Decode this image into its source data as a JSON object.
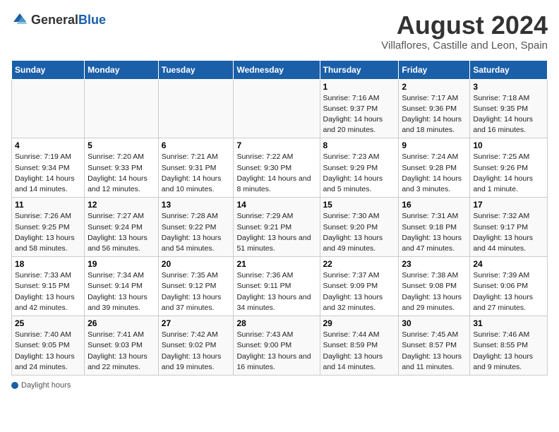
{
  "header": {
    "logo_general": "General",
    "logo_blue": "Blue",
    "title": "August 2024",
    "subtitle": "Villaflores, Castille and Leon, Spain"
  },
  "days_of_week": [
    "Sunday",
    "Monday",
    "Tuesday",
    "Wednesday",
    "Thursday",
    "Friday",
    "Saturday"
  ],
  "weeks": [
    [
      {
        "day": "",
        "content": ""
      },
      {
        "day": "",
        "content": ""
      },
      {
        "day": "",
        "content": ""
      },
      {
        "day": "",
        "content": ""
      },
      {
        "day": "1",
        "content": "Sunrise: 7:16 AM\nSunset: 9:37 PM\nDaylight: 14 hours\nand 20 minutes."
      },
      {
        "day": "2",
        "content": "Sunrise: 7:17 AM\nSunset: 9:36 PM\nDaylight: 14 hours\nand 18 minutes."
      },
      {
        "day": "3",
        "content": "Sunrise: 7:18 AM\nSunset: 9:35 PM\nDaylight: 14 hours\nand 16 minutes."
      }
    ],
    [
      {
        "day": "4",
        "content": "Sunrise: 7:19 AM\nSunset: 9:34 PM\nDaylight: 14 hours\nand 14 minutes."
      },
      {
        "day": "5",
        "content": "Sunrise: 7:20 AM\nSunset: 9:33 PM\nDaylight: 14 hours\nand 12 minutes."
      },
      {
        "day": "6",
        "content": "Sunrise: 7:21 AM\nSunset: 9:31 PM\nDaylight: 14 hours\nand 10 minutes."
      },
      {
        "day": "7",
        "content": "Sunrise: 7:22 AM\nSunset: 9:30 PM\nDaylight: 14 hours\nand 8 minutes."
      },
      {
        "day": "8",
        "content": "Sunrise: 7:23 AM\nSunset: 9:29 PM\nDaylight: 14 hours\nand 5 minutes."
      },
      {
        "day": "9",
        "content": "Sunrise: 7:24 AM\nSunset: 9:28 PM\nDaylight: 14 hours\nand 3 minutes."
      },
      {
        "day": "10",
        "content": "Sunrise: 7:25 AM\nSunset: 9:26 PM\nDaylight: 14 hours\nand 1 minute."
      }
    ],
    [
      {
        "day": "11",
        "content": "Sunrise: 7:26 AM\nSunset: 9:25 PM\nDaylight: 13 hours\nand 58 minutes."
      },
      {
        "day": "12",
        "content": "Sunrise: 7:27 AM\nSunset: 9:24 PM\nDaylight: 13 hours\nand 56 minutes."
      },
      {
        "day": "13",
        "content": "Sunrise: 7:28 AM\nSunset: 9:22 PM\nDaylight: 13 hours\nand 54 minutes."
      },
      {
        "day": "14",
        "content": "Sunrise: 7:29 AM\nSunset: 9:21 PM\nDaylight: 13 hours\nand 51 minutes."
      },
      {
        "day": "15",
        "content": "Sunrise: 7:30 AM\nSunset: 9:20 PM\nDaylight: 13 hours\nand 49 minutes."
      },
      {
        "day": "16",
        "content": "Sunrise: 7:31 AM\nSunset: 9:18 PM\nDaylight: 13 hours\nand 47 minutes."
      },
      {
        "day": "17",
        "content": "Sunrise: 7:32 AM\nSunset: 9:17 PM\nDaylight: 13 hours\nand 44 minutes."
      }
    ],
    [
      {
        "day": "18",
        "content": "Sunrise: 7:33 AM\nSunset: 9:15 PM\nDaylight: 13 hours\nand 42 minutes."
      },
      {
        "day": "19",
        "content": "Sunrise: 7:34 AM\nSunset: 9:14 PM\nDaylight: 13 hours\nand 39 minutes."
      },
      {
        "day": "20",
        "content": "Sunrise: 7:35 AM\nSunset: 9:12 PM\nDaylight: 13 hours\nand 37 minutes."
      },
      {
        "day": "21",
        "content": "Sunrise: 7:36 AM\nSunset: 9:11 PM\nDaylight: 13 hours\nand 34 minutes."
      },
      {
        "day": "22",
        "content": "Sunrise: 7:37 AM\nSunset: 9:09 PM\nDaylight: 13 hours\nand 32 minutes."
      },
      {
        "day": "23",
        "content": "Sunrise: 7:38 AM\nSunset: 9:08 PM\nDaylight: 13 hours\nand 29 minutes."
      },
      {
        "day": "24",
        "content": "Sunrise: 7:39 AM\nSunset: 9:06 PM\nDaylight: 13 hours\nand 27 minutes."
      }
    ],
    [
      {
        "day": "25",
        "content": "Sunrise: 7:40 AM\nSunset: 9:05 PM\nDaylight: 13 hours\nand 24 minutes."
      },
      {
        "day": "26",
        "content": "Sunrise: 7:41 AM\nSunset: 9:03 PM\nDaylight: 13 hours\nand 22 minutes."
      },
      {
        "day": "27",
        "content": "Sunrise: 7:42 AM\nSunset: 9:02 PM\nDaylight: 13 hours\nand 19 minutes."
      },
      {
        "day": "28",
        "content": "Sunrise: 7:43 AM\nSunset: 9:00 PM\nDaylight: 13 hours\nand 16 minutes."
      },
      {
        "day": "29",
        "content": "Sunrise: 7:44 AM\nSunset: 8:59 PM\nDaylight: 13 hours\nand 14 minutes."
      },
      {
        "day": "30",
        "content": "Sunrise: 7:45 AM\nSunset: 8:57 PM\nDaylight: 13 hours\nand 11 minutes."
      },
      {
        "day": "31",
        "content": "Sunrise: 7:46 AM\nSunset: 8:55 PM\nDaylight: 13 hours\nand 9 minutes."
      }
    ]
  ],
  "footer": {
    "label": "Daylight hours"
  }
}
